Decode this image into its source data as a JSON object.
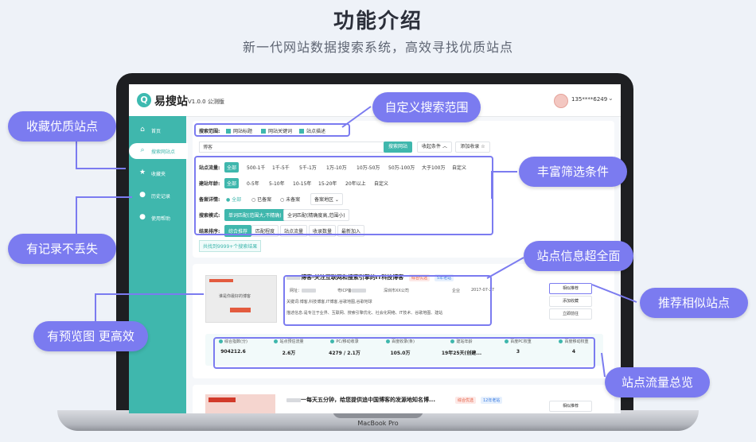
{
  "header": {
    "title": "功能介绍",
    "subtitle": "新一代网站数据搜索系统，高效寻找优质站点"
  },
  "app": {
    "logo_mark": "Q",
    "name": "易搜站",
    "version": "V1.0.0 公测版",
    "user": "135****6249",
    "accent": "#3fb7ad"
  },
  "sidebar": {
    "items": [
      {
        "icon": "home-icon",
        "glyph": "⌂",
        "label": "首页"
      },
      {
        "icon": "search-icon",
        "glyph": "⌕",
        "label": "搜索网站点"
      },
      {
        "icon": "star-icon",
        "glyph": "★",
        "label": "收藏夹"
      },
      {
        "icon": "history-icon",
        "glyph": "●",
        "label": "历史记录"
      },
      {
        "icon": "help-icon",
        "glyph": "●",
        "label": "使用帮助"
      }
    ]
  },
  "search": {
    "scope_label": "搜索范围:",
    "scopes": [
      "网站标题",
      "网站关键词",
      "站点描述"
    ],
    "query": "博客",
    "search_btn": "搜索网站",
    "condition_btn": "收起条件 ︿",
    "favorite_btn": "添加收录 ☆"
  },
  "filters": {
    "traffic_label": "站点流量:",
    "traffic": [
      "全部",
      "500-1千",
      "1千-5千",
      "5千-1万",
      "1万-10万",
      "10万-50万",
      "50万-100万",
      "大于100万",
      "自定义"
    ],
    "age_label": "建站年龄:",
    "age": [
      "全部",
      "0-5年",
      "5-10年",
      "10-15年",
      "15-20年",
      "20年以上",
      "自定义"
    ],
    "icp_label": "备案详情:",
    "icp": [
      "全部",
      "已备案",
      "未备案"
    ],
    "icp_region": "备案地区 ⌄",
    "mode_label": "搜索模式:",
    "modes": [
      "单词匹配(范围大,不精确)",
      "全词匹配(精确度高,范围小)"
    ],
    "sort_label": "结果排序:",
    "sorts": [
      "综合推荐",
      "匹配程度",
      "站点流量",
      "收录数量",
      "最新加入"
    ],
    "result_count": "共找到9999+个搜索结果"
  },
  "result": {
    "title": "博客-关注互联网和搜索引擎的IT科技博客",
    "badge1": "综合优选",
    "badge2": "5年老站",
    "url_label": "网址：",
    "icp_label": "粤ICP备",
    "company": "深圳市XX公司",
    "type": "企业",
    "date": "2017-07-27",
    "keywords": "关键词:",
    "keywords_text": "博客,科技博客,IT博客,谷歌地图,谷歌地球",
    "desc": "描述信息:",
    "desc_text": "是专注于业界、互联网、搜索引擎优化、社会化网络、IT技术、谷歌地图、建站",
    "thumb_text": "谁是你最好的博客",
    "actions": [
      "相似推荐",
      "添加收藏",
      "立即前往"
    ],
    "stats": [
      {
        "label": "综合指数(分)",
        "value": "904212.6"
      },
      {
        "label": "站点预估流量",
        "value": "2.6万"
      },
      {
        "label": "PC/移动收录",
        "value": "4279 / 2.1万"
      },
      {
        "label": "百度收录(条)",
        "value": "105.0万"
      },
      {
        "label": "建站年龄",
        "value": "19年25天(创建..."
      },
      {
        "label": "百度PC权重",
        "value": "3"
      },
      {
        "label": "百度移动权重",
        "value": "4"
      }
    ]
  },
  "result2": {
    "title": "一每天五分钟，给您提供追中国博客的发源地知名博...",
    "badge1": "综合优选",
    "badge2": "12年老站",
    "action": "相似推荐"
  },
  "callouts": {
    "favorites": "收藏优质站点",
    "custom_scope": "自定义搜索范围",
    "rich_filters": "丰富筛选条件",
    "history": "有记录不丢失",
    "site_info": "站点信息超全面",
    "similar": "推荐相似站点",
    "preview": "有预览图 更高效",
    "traffic": "站点流量总览"
  },
  "device_label": "MacBook Pro"
}
